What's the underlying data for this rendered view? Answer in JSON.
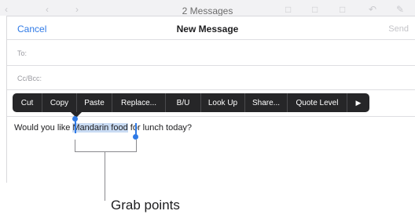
{
  "background_toolbar": {
    "title": "2 Messages",
    "icons": [
      "back-chevron-icon",
      "forward-chevron-icon",
      "flag-icon",
      "folder-icon",
      "trash-icon",
      "reply-icon",
      "compose-icon"
    ]
  },
  "compose": {
    "cancel_label": "Cancel",
    "title": "New Message",
    "send_label": "Send",
    "to_label": "To:",
    "ccbcc_label": "Cc/Bcc:"
  },
  "edit_menu": {
    "items": [
      "Cut",
      "Copy",
      "Paste",
      "Replace...",
      "B/U",
      "Look Up",
      "Share...",
      "Quote Level"
    ],
    "more_icon": "play-arrow-icon"
  },
  "body": {
    "text_before": "Would you like ",
    "selected_text": "Mandarin food",
    "text_after": " for lunch today?"
  },
  "caption": "Grab points",
  "colors": {
    "accent": "#2f7ae6",
    "menu_bg": "#262628",
    "selection": "#c9dbf3",
    "callout_line": "#8a8a8e"
  }
}
